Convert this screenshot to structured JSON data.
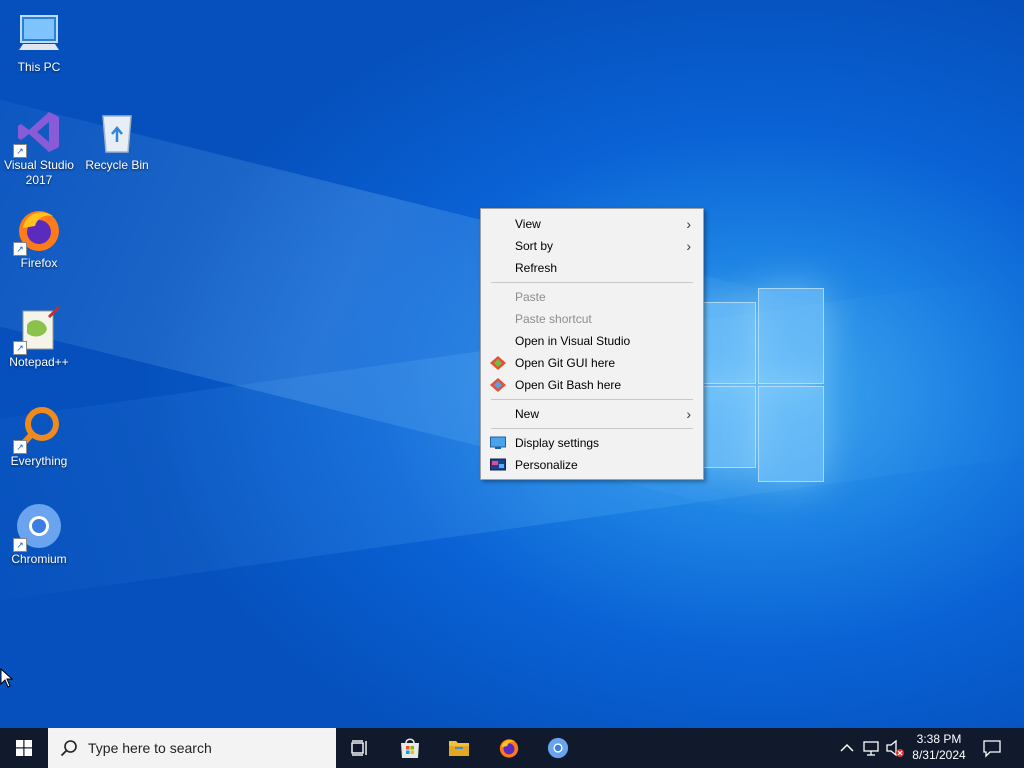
{
  "desktop": {
    "icons": [
      {
        "label": "This PC"
      },
      {
        "label": "Visual Studio 2017"
      },
      {
        "label": "Recycle Bin"
      },
      {
        "label": "Firefox"
      },
      {
        "label": "Notepad++"
      },
      {
        "label": "Everything"
      },
      {
        "label": "Chromium"
      }
    ]
  },
  "context_menu": {
    "items": [
      {
        "label": "View",
        "submenu": true
      },
      {
        "label": "Sort by",
        "submenu": true
      },
      {
        "label": "Refresh"
      },
      {
        "label": "Paste",
        "disabled": true
      },
      {
        "label": "Paste shortcut",
        "disabled": true
      },
      {
        "label": "Open in Visual Studio"
      },
      {
        "label": "Open Git GUI here",
        "icon": "git-gui-icon"
      },
      {
        "label": "Open Git Bash here",
        "icon": "git-bash-icon"
      },
      {
        "label": "New",
        "submenu": true
      },
      {
        "label": "Display settings",
        "icon": "display-settings-icon"
      },
      {
        "label": "Personalize",
        "icon": "personalize-icon"
      }
    ]
  },
  "taskbar": {
    "search_placeholder": "Type here to search",
    "pinned": [
      "task-view-icon",
      "microsoft-store-icon",
      "file-explorer-icon",
      "firefox-icon",
      "chromium-icon"
    ],
    "clock": {
      "time": "3:38 PM",
      "date": "8/31/2024"
    }
  },
  "colors": {
    "taskbar": "#101a2c",
    "menu_bg": "#f2f2f2",
    "desktop_blue": "#0a62d4"
  }
}
